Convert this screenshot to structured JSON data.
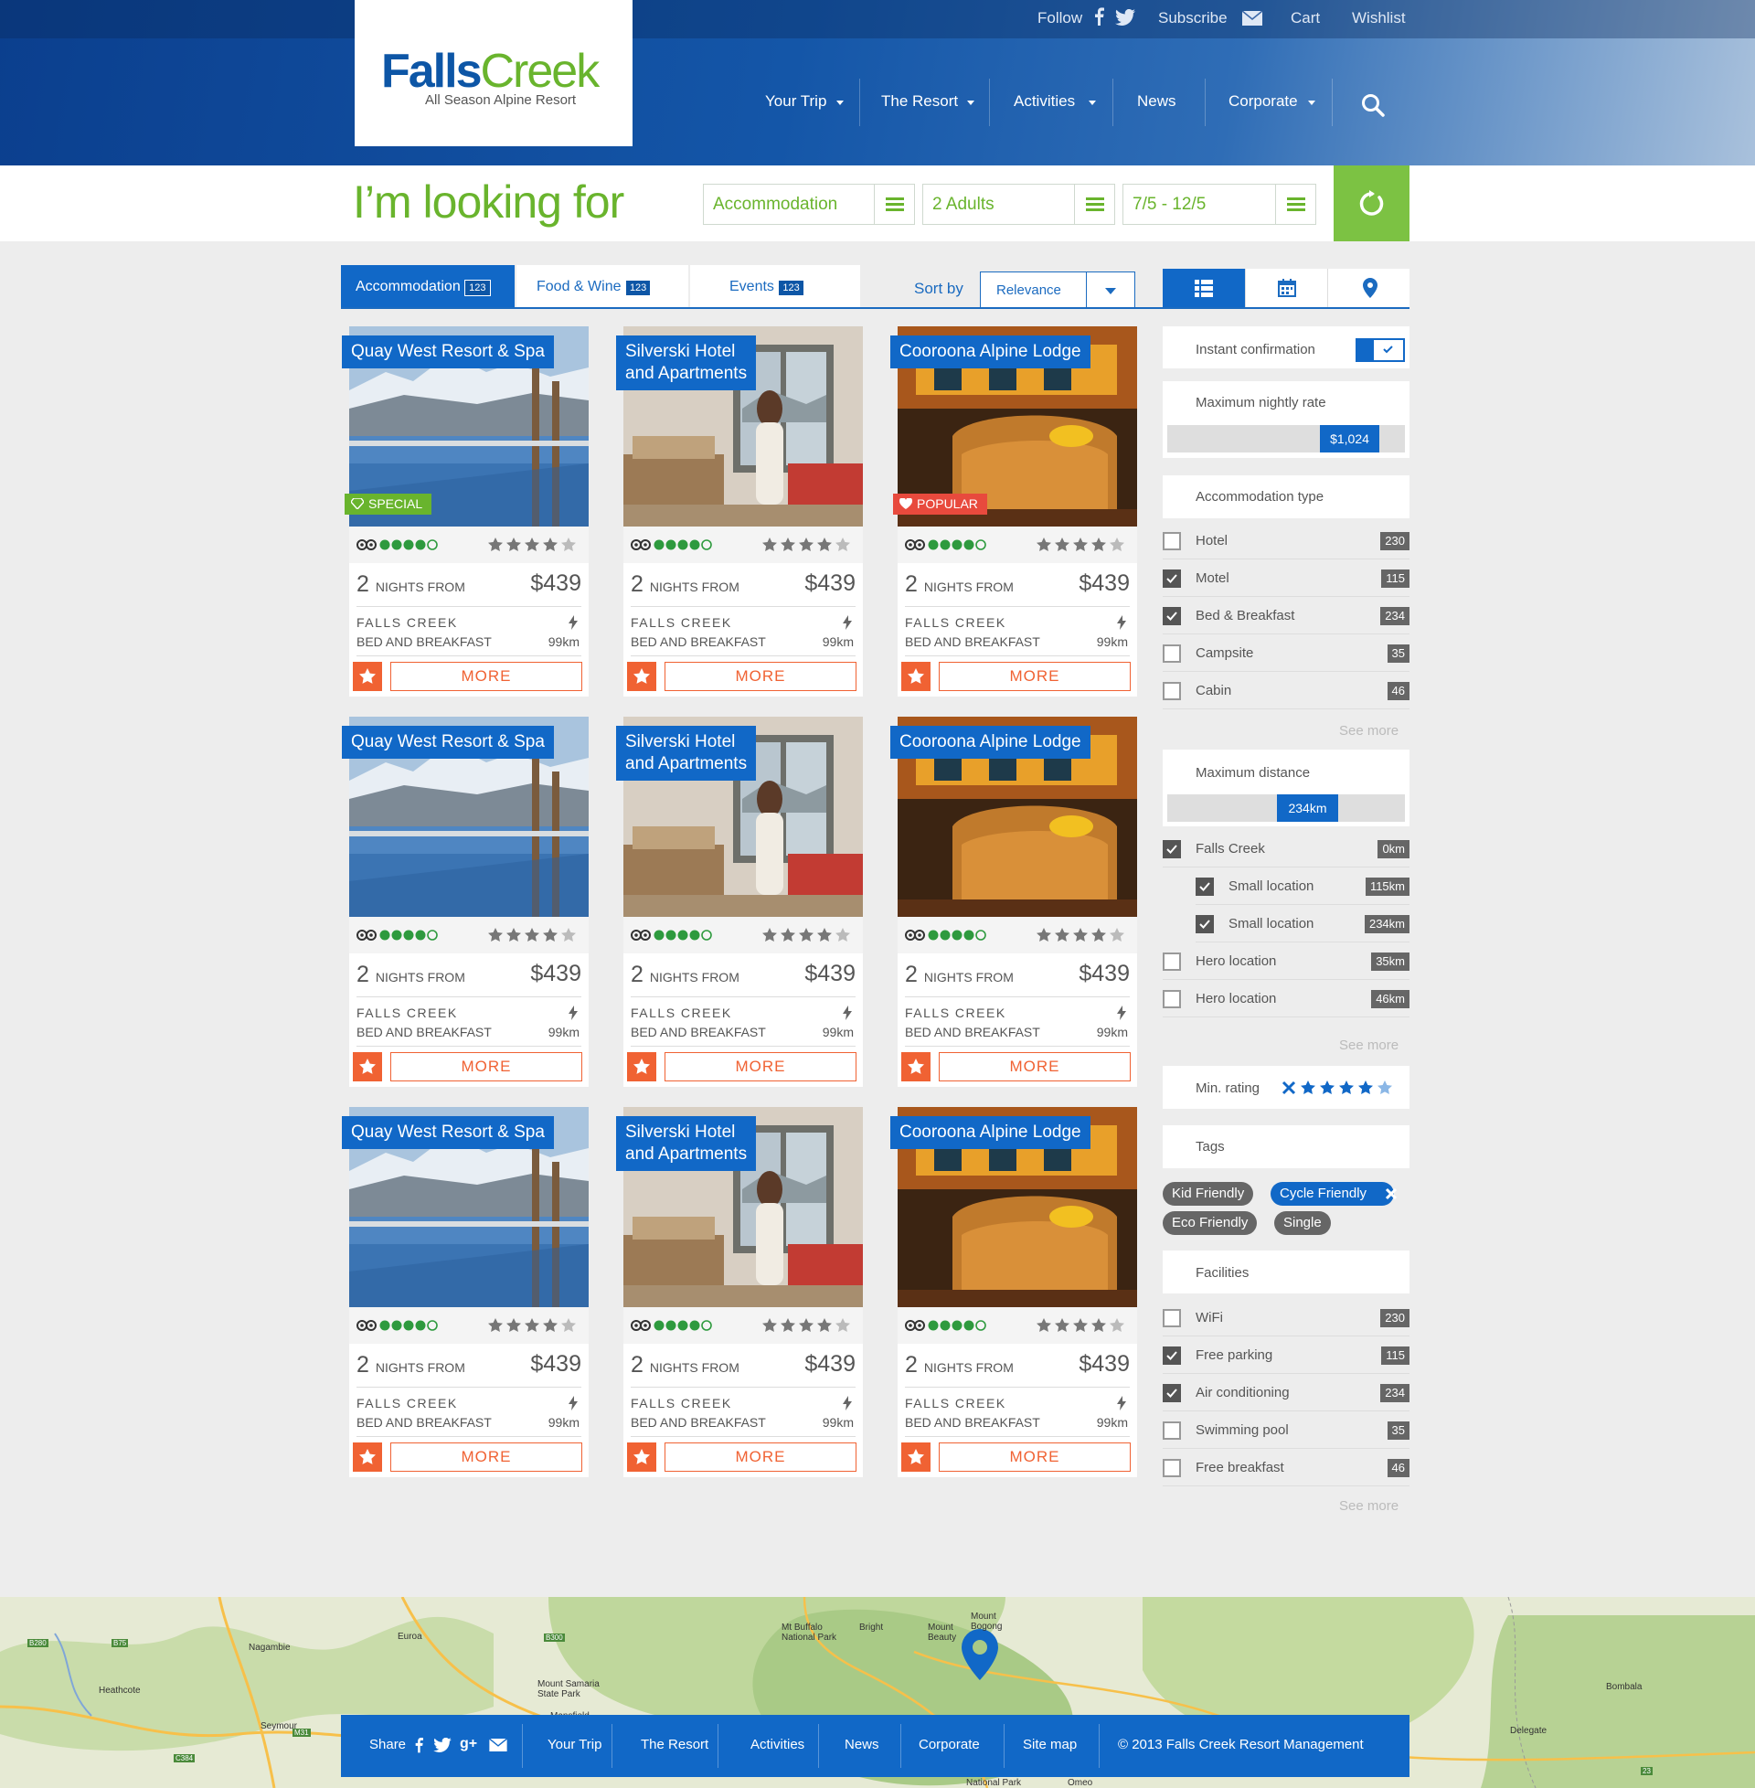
{
  "topbar": {
    "follow": "Follow",
    "subscribe": "Subscribe",
    "cart": "Cart",
    "wishlist": "Wishlist"
  },
  "logo": {
    "name_a": "Falls",
    "name_b": "Creek",
    "tagline": "All Season Alpine Resort"
  },
  "nav": {
    "items": [
      "Your Trip",
      "The Resort",
      "Activities",
      "News",
      "Corporate"
    ]
  },
  "search": {
    "heading": "I’m looking for",
    "category": "Accommodation",
    "guests": "2 Adults",
    "dates": "7/5 - 12/5"
  },
  "tabs": [
    {
      "label": "Accommodation",
      "count": "123"
    },
    {
      "label": "Food & Wine",
      "count": "123"
    },
    {
      "label": "Events",
      "count": "123"
    }
  ],
  "sort": {
    "label": "Sort by",
    "value": "Relevance"
  },
  "cards": [
    {
      "title": "Quay West Resort & Spa",
      "ribbon": "SPECIAL",
      "nights": "2",
      "nights_label": "NIGHTS FROM",
      "price": "$439",
      "location": "FALLS CREEK",
      "type": "BED AND BREAKFAST",
      "distance": "99km",
      "more": "MORE"
    },
    {
      "title": "Silverski Hotel\nand Apartments",
      "ribbon": "",
      "nights": "2",
      "nights_label": "NIGHTS FROM",
      "price": "$439",
      "location": "FALLS CREEK",
      "type": "BED AND BREAKFAST",
      "distance": "99km",
      "more": "MORE"
    },
    {
      "title": "Cooroona Alpine Lodge",
      "ribbon": "POPULAR",
      "nights": "2",
      "nights_label": "NIGHTS FROM",
      "price": "$439",
      "location": "FALLS CREEK",
      "type": "BED AND BREAKFAST",
      "distance": "99km",
      "more": "MORE"
    },
    {
      "title": "Quay West Resort & Spa",
      "ribbon": "",
      "nights": "2",
      "nights_label": "NIGHTS FROM",
      "price": "$439",
      "location": "FALLS CREEK",
      "type": "BED AND BREAKFAST",
      "distance": "99km",
      "more": "MORE"
    },
    {
      "title": "Silverski Hotel\nand Apartments",
      "ribbon": "",
      "nights": "2",
      "nights_label": "NIGHTS FROM",
      "price": "$439",
      "location": "FALLS CREEK",
      "type": "BED AND BREAKFAST",
      "distance": "99km",
      "more": "MORE"
    },
    {
      "title": "Cooroona Alpine Lodge",
      "ribbon": "",
      "nights": "2",
      "nights_label": "NIGHTS FROM",
      "price": "$439",
      "location": "FALLS CREEK",
      "type": "BED AND BREAKFAST",
      "distance": "99km",
      "more": "MORE"
    },
    {
      "title": "Quay West Resort & Spa",
      "ribbon": "",
      "nights": "2",
      "nights_label": "NIGHTS FROM",
      "price": "$439",
      "location": "FALLS CREEK",
      "type": "BED AND BREAKFAST",
      "distance": "99km",
      "more": "MORE"
    },
    {
      "title": "Silverski Hotel\nand Apartments",
      "ribbon": "",
      "nights": "2",
      "nights_label": "NIGHTS FROM",
      "price": "$439",
      "location": "FALLS CREEK",
      "type": "BED AND BREAKFAST",
      "distance": "99km",
      "more": "MORE"
    },
    {
      "title": "Cooroona Alpine Lodge",
      "ribbon": "",
      "nights": "2",
      "nights_label": "NIGHTS FROM",
      "price": "$439",
      "location": "FALLS CREEK",
      "type": "BED AND BREAKFAST",
      "distance": "99km",
      "more": "MORE"
    }
  ],
  "filters": {
    "instant": "Instant confirmation",
    "max_rate": {
      "label": "Maximum nightly rate",
      "value": "$1,024"
    },
    "acc_type": {
      "label": "Accommodation type",
      "items": [
        {
          "name": "Hotel",
          "count": "230",
          "checked": false
        },
        {
          "name": "Motel",
          "count": "115",
          "checked": true
        },
        {
          "name": "Bed & Breakfast",
          "count": "234",
          "checked": true
        },
        {
          "name": "Campsite",
          "count": "35",
          "checked": false
        },
        {
          "name": "Cabin",
          "count": "46",
          "checked": false
        }
      ]
    },
    "see_more": "See more",
    "max_distance": {
      "label": "Maximum distance",
      "value": "234km"
    },
    "locations": [
      {
        "name": "Falls Creek",
        "count": "0km",
        "checked": true
      },
      {
        "name": "Small location",
        "count": "115km",
        "checked": true
      },
      {
        "name": "Small location",
        "count": "234km",
        "checked": true
      },
      {
        "name": "Hero location",
        "count": "35km",
        "checked": false
      },
      {
        "name": "Hero location",
        "count": "46km",
        "checked": false
      }
    ],
    "min_rating": "Min. rating",
    "tags": {
      "label": "Tags",
      "items": [
        "Kid Friendly",
        "Cycle Friendly",
        "Eco Friendly",
        "Single"
      ]
    },
    "facilities": {
      "label": "Facilities",
      "items": [
        {
          "name": "WiFi",
          "count": "230",
          "checked": false
        },
        {
          "name": "Free parking",
          "count": "115",
          "checked": true
        },
        {
          "name": "Air conditioning",
          "count": "234",
          "checked": true
        },
        {
          "name": "Swimming pool",
          "count": "35",
          "checked": false
        },
        {
          "name": "Free breakfast",
          "count": "46",
          "checked": false
        }
      ]
    }
  },
  "map": {
    "places": [
      "Euroa",
      "Nagambie",
      "Heathcote",
      "Seymour",
      "Mt Buffalo\nNational Park",
      "Bright",
      "Mount\nBeauty",
      "Mount\nBogong",
      "Mount Samaria\nState Park",
      "Mansfield",
      "Bombala",
      "Delegate",
      "Omeo",
      "National Park"
    ],
    "roads": [
      "B280",
      "B75",
      "B300",
      "M31",
      "C384",
      "B500",
      "23"
    ]
  },
  "footer": {
    "share": "Share",
    "links": [
      "Your Trip",
      "The Resort",
      "Activities",
      "News",
      "Corporate",
      "Site map"
    ],
    "copyright": "© 2013 Falls Creek Resort Management"
  },
  "colors": {
    "brand_blue": "#1168c7",
    "brand_green": "#69b42d",
    "accent_orange": "#f06233"
  }
}
